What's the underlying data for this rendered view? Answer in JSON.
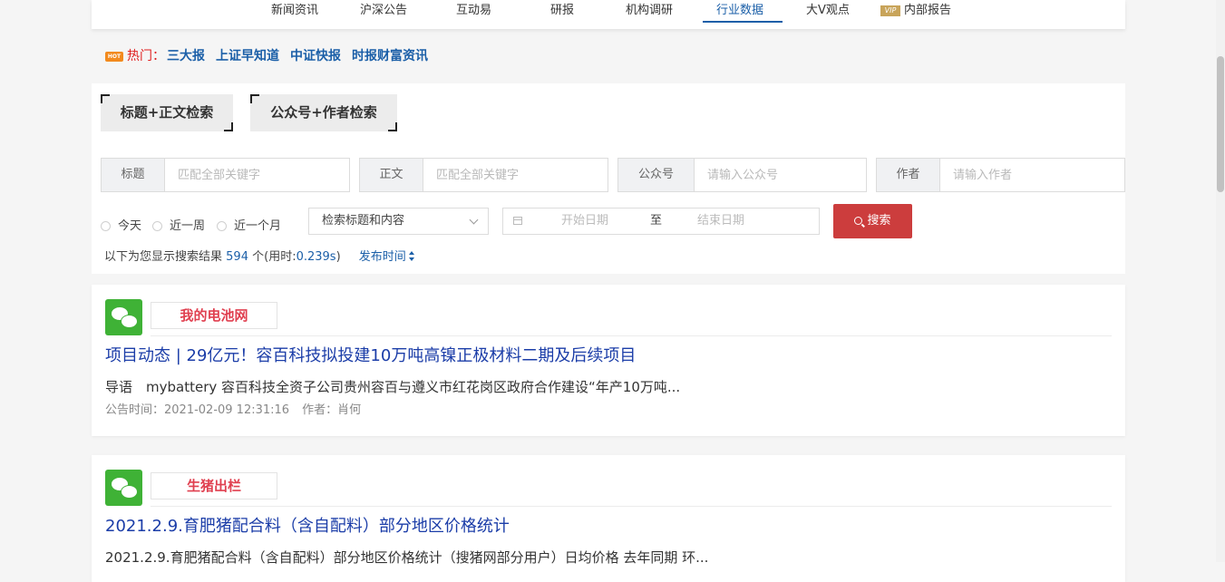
{
  "topnav": {
    "items": [
      "新闻资讯",
      "沪深公告",
      "互动易",
      "研报",
      "机构调研",
      "行业数据",
      "大V观点",
      "内部报告"
    ],
    "active_index": 5,
    "vip_badge": "VIP"
  },
  "hot": {
    "badge": "HOT",
    "label": "热门：",
    "links": [
      "三大报",
      "上证早知道",
      "中证快报",
      "时报财富资讯"
    ]
  },
  "search": {
    "mode_tabs": [
      "标题+正文检索",
      "公众号+作者检索"
    ],
    "fields": [
      {
        "label": "标题",
        "placeholder": "匹配全部关键字"
      },
      {
        "label": "正文",
        "placeholder": "匹配全部关键字"
      },
      {
        "label": "公众号",
        "placeholder": "请输入公众号"
      },
      {
        "label": "作者",
        "placeholder": "请输入作者"
      }
    ],
    "time_options": [
      "今天",
      "近一周",
      "近一个月"
    ],
    "scope_select": "检索标题和内容",
    "date_start_placeholder": "开始日期",
    "date_separator": "至",
    "date_end_placeholder": "结束日期",
    "button_label": "搜索"
  },
  "results_summary": {
    "prefix": "以下为您显示搜索结果",
    "count": "594",
    "unit": "个(用时:",
    "time": "0.239s",
    "suffix": ")",
    "sort_label": "发布时间"
  },
  "results": [
    {
      "account": "我的电池网",
      "title": "项目动态 | 29亿元！容百科技拟投建10万吨高镍正极材料二期及后续项目",
      "summary": "导语　mybattery 容百科技全资子公司贵州容百与遵义市红花岗区政府合作建设“年产10万吨...",
      "time": "公告时间：2021-02-09 12:31:16",
      "author": "作者：肖何"
    },
    {
      "account": "生猪出栏",
      "title": "2021.2.9.育肥猪配合料（含自配料）部分地区价格统计",
      "summary": "2021.2.9.育肥猪配合料（含自配料）部分地区价格统计（搜猪网部分用户）日均价格 去年同期 环...",
      "time": "",
      "author": ""
    }
  ]
}
